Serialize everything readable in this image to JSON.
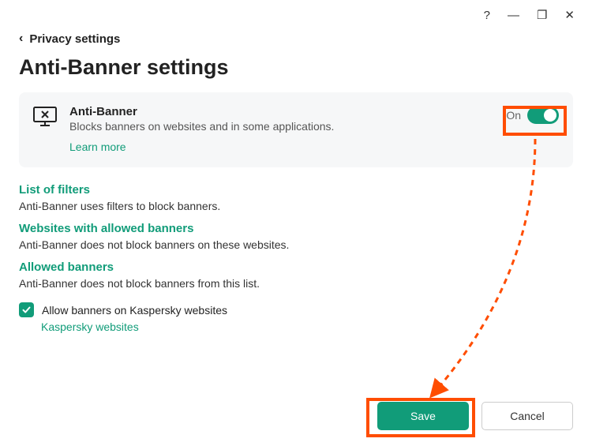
{
  "window": {
    "help": "?",
    "minimize": "—",
    "maximize": "❐",
    "close": "✕"
  },
  "breadcrumb": {
    "back": "‹",
    "label": "Privacy settings"
  },
  "title": "Anti-Banner settings",
  "card": {
    "title": "Anti-Banner",
    "desc": "Blocks banners on websites and in some applications.",
    "learn_more": "Learn more",
    "toggle_state": "On"
  },
  "sections": {
    "filters": {
      "heading": "List of filters",
      "desc": "Anti-Banner uses filters to block banners."
    },
    "allowed_sites": {
      "heading": "Websites with allowed banners",
      "desc": "Anti-Banner does not block banners on these websites."
    },
    "allowed_banners": {
      "heading": "Allowed banners",
      "desc": "Anti-Banner does not block banners from this list."
    }
  },
  "checkbox": {
    "label": "Allow banners on Kaspersky websites",
    "sublink": "Kaspersky websites"
  },
  "buttons": {
    "save": "Save",
    "cancel": "Cancel"
  },
  "colors": {
    "accent": "#119c79",
    "highlight": "#ff4d00"
  }
}
